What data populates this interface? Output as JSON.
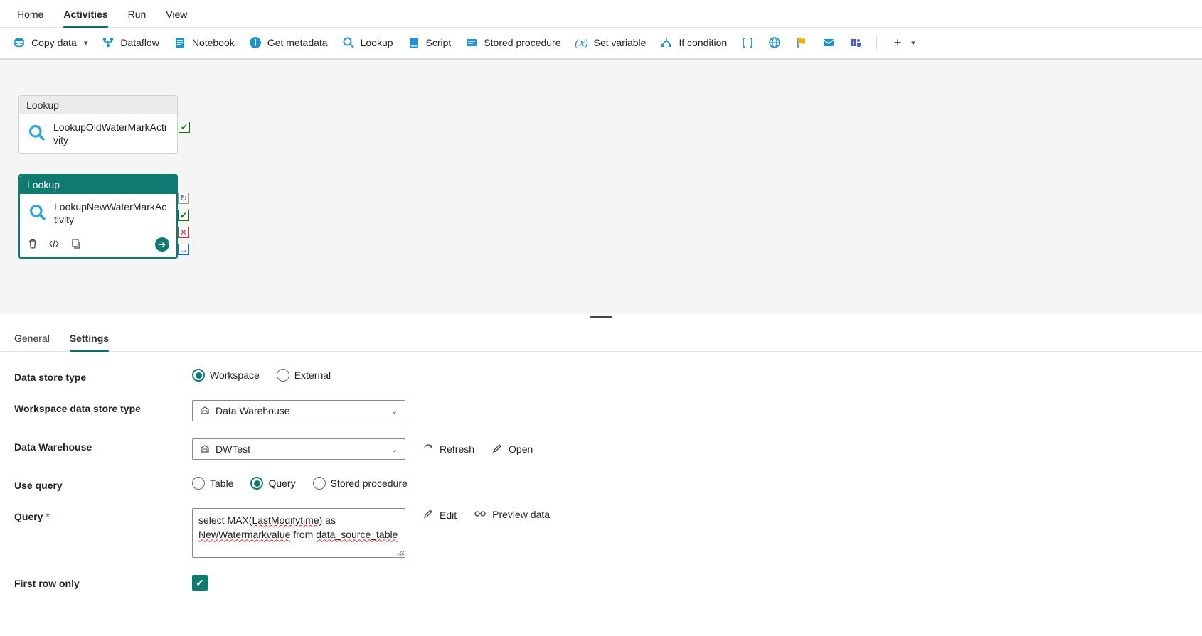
{
  "top_tabs": {
    "items": [
      "Home",
      "Activities",
      "Run",
      "View"
    ],
    "active_index": 1
  },
  "toolbar": {
    "copy_data": "Copy data",
    "dataflow": "Dataflow",
    "notebook": "Notebook",
    "get_metadata": "Get metadata",
    "lookup": "Lookup",
    "script": "Script",
    "stored_procedure": "Stored procedure",
    "set_variable": "Set variable",
    "if_condition": "If condition"
  },
  "canvas": {
    "activities": [
      {
        "type": "Lookup",
        "name": "LookupOldWaterMarkActivity",
        "selected": false
      },
      {
        "type": "Lookup",
        "name": "LookupNewWaterMarkActivity",
        "selected": true
      }
    ]
  },
  "detail_tabs": {
    "items": [
      "General",
      "Settings"
    ],
    "active_index": 1
  },
  "settings": {
    "labels": {
      "data_store_type": "Data store type",
      "workspace_data_store_type": "Workspace data store type",
      "data_warehouse": "Data Warehouse",
      "use_query": "Use query",
      "query": "Query",
      "first_row_only": "First row only"
    },
    "data_store_type": {
      "options": [
        "Workspace",
        "External"
      ],
      "selected": "Workspace"
    },
    "workspace_data_store_type": {
      "value": "Data Warehouse"
    },
    "data_warehouse": {
      "value": "DWTest",
      "refresh": "Refresh",
      "open": "Open"
    },
    "use_query": {
      "options": [
        "Table",
        "Query",
        "Stored procedure"
      ],
      "selected": "Query"
    },
    "query": {
      "value": "select MAX(LastModifytime) as NewWatermarkvalue from data_source_table",
      "edit": "Edit",
      "preview": "Preview data"
    },
    "first_row_only": {
      "checked": true
    }
  }
}
